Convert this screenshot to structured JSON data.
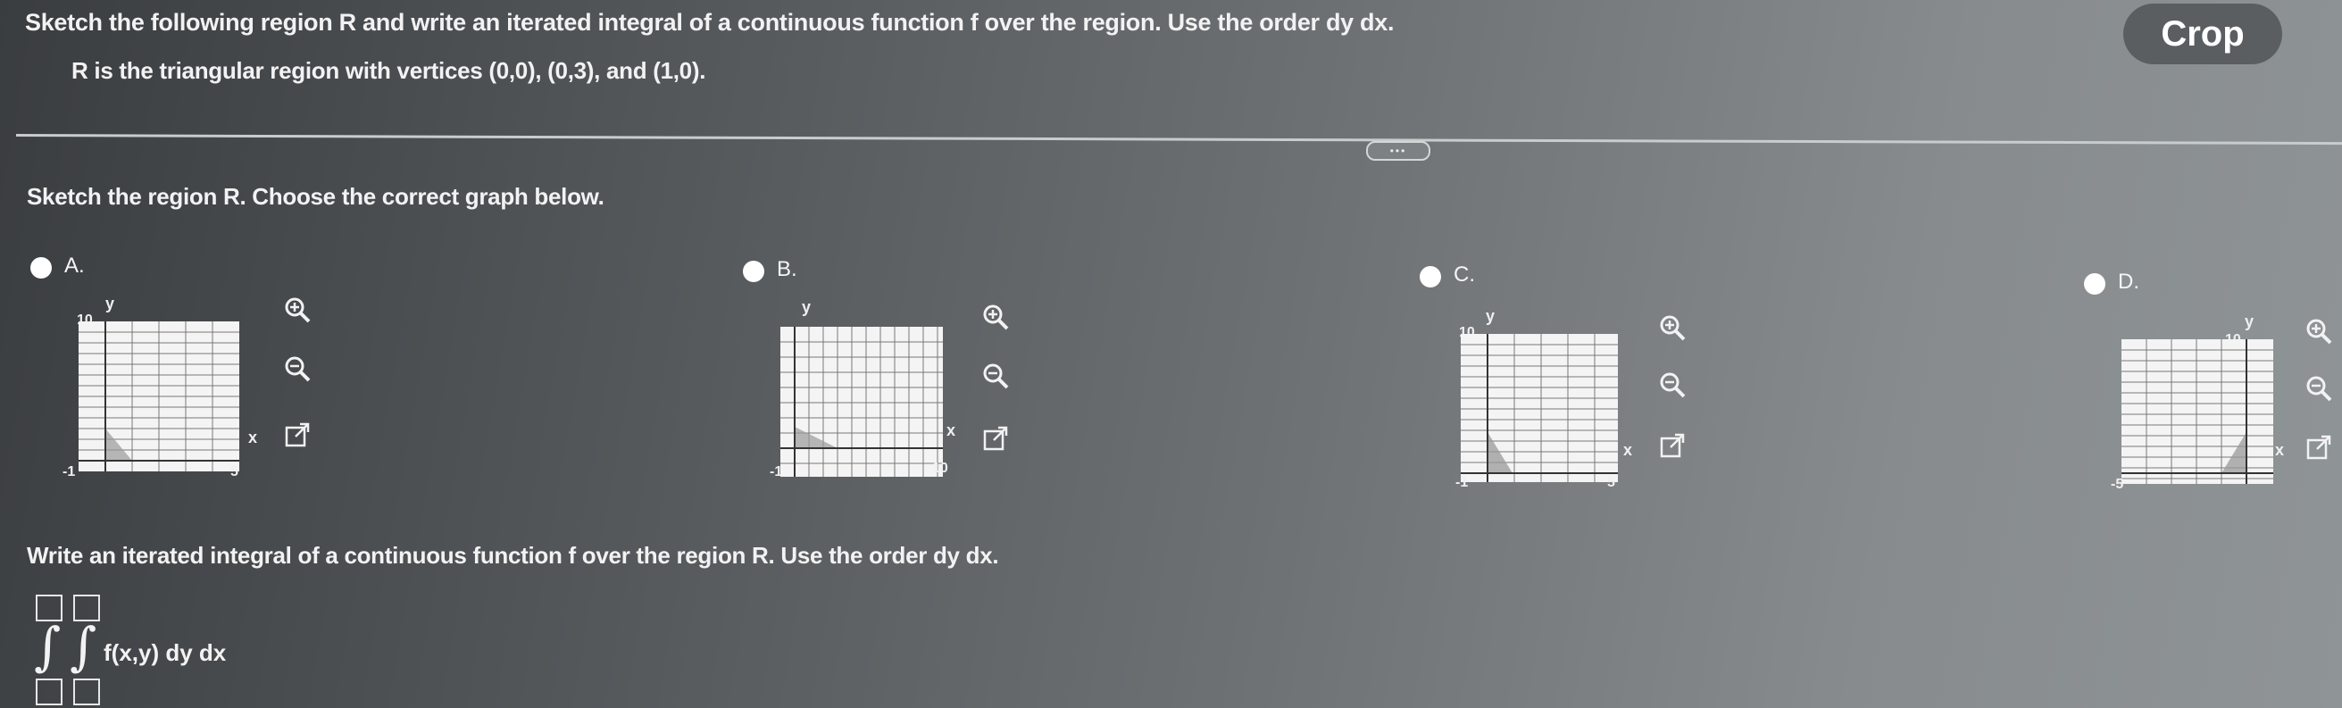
{
  "question": {
    "title": "Sketch the following region R and write an iterated integral of a continuous function f over the region. Use the order dy dx.",
    "region": "R is the triangular region with vertices (0,0), (0,3), and (1,0)."
  },
  "crop_button": "Crop",
  "more_button": "•••",
  "part1": {
    "prompt": "Sketch the region R. Choose the correct graph below."
  },
  "options": [
    {
      "label": "A.",
      "ymax": "10",
      "xmax": "5",
      "min": "-1"
    },
    {
      "label": "B.",
      "xmax": "10",
      "min": "-1"
    },
    {
      "label": "C.",
      "ymax": "10",
      "xmax": "5",
      "min": "-1"
    },
    {
      "label": "D.",
      "ymax": "10",
      "min": "-5"
    }
  ],
  "axis_names": {
    "x": "x",
    "y": "y"
  },
  "part2": {
    "prompt": "Write an iterated integral of a continuous function f over the region R. Use the order dy dx.",
    "integrand": "f(x,y) dy dx"
  },
  "colors": {
    "radio": "#ffffff",
    "graph_bg": "#f4f4f4",
    "region_fill": "#9a9a9a"
  },
  "icons": [
    "zoom-in-icon",
    "zoom-out-icon",
    "external-link-icon"
  ]
}
